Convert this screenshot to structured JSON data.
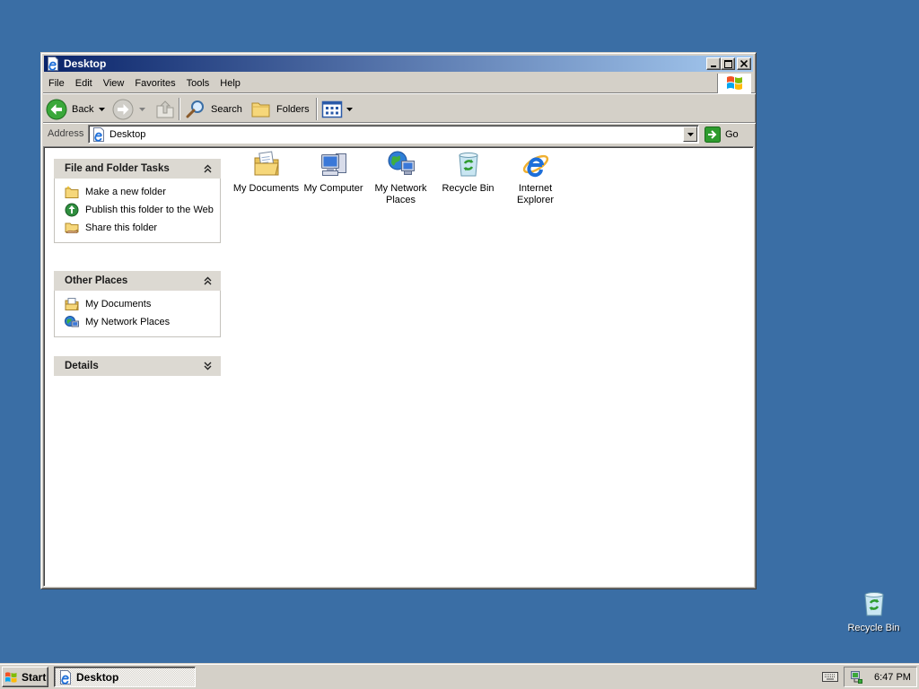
{
  "window": {
    "title": "Desktop",
    "title_icon": "ie-page-icon",
    "controls": [
      "minimize-icon",
      "maximize-icon",
      "close-icon"
    ]
  },
  "menu": [
    "File",
    "Edit",
    "View",
    "Favorites",
    "Tools",
    "Help"
  ],
  "toolbar": {
    "back_label": "Back",
    "search_label": "Search",
    "folders_label": "Folders",
    "icons": [
      "back-arrow-icon",
      "forward-arrow-icon",
      "up-folder-icon",
      "search-icon",
      "folders-icon",
      "views-icon"
    ]
  },
  "address": {
    "label": "Address",
    "value": "Desktop",
    "go_label": "Go"
  },
  "task_pane": {
    "file_folder_tasks": {
      "title": "File and Folder Tasks",
      "items": [
        {
          "label": "Make a new folder",
          "icon": "new-folder-icon"
        },
        {
          "label": "Publish this folder to the Web",
          "icon": "publish-web-icon"
        },
        {
          "label": "Share this folder",
          "icon": "share-folder-icon"
        }
      ]
    },
    "other_places": {
      "title": "Other Places",
      "items": [
        {
          "label": "My Documents",
          "icon": "my-documents-icon"
        },
        {
          "label": "My Network Places",
          "icon": "my-network-places-icon"
        }
      ]
    },
    "details": {
      "title": "Details"
    }
  },
  "items": [
    {
      "label": "My Documents",
      "icon": "my-documents-icon"
    },
    {
      "label": "My Computer",
      "icon": "my-computer-icon"
    },
    {
      "label": "My Network Places",
      "icon": "my-network-places-icon"
    },
    {
      "label": "Recycle Bin",
      "icon": "recycle-bin-icon"
    },
    {
      "label": "Internet Explorer",
      "icon": "internet-explorer-icon"
    }
  ],
  "desktop": {
    "icons": [
      {
        "label": "Recycle Bin",
        "icon": "recycle-bin-icon"
      }
    ]
  },
  "taskbar": {
    "start_label": "Start",
    "task_button_label": "Desktop",
    "clock": "6:47 PM"
  },
  "colors": {
    "desktop_background": "#3a6ea5",
    "title_bar_start": "#0a246a",
    "title_bar_end": "#a6caf0",
    "window_face": "#d4d0c8"
  }
}
